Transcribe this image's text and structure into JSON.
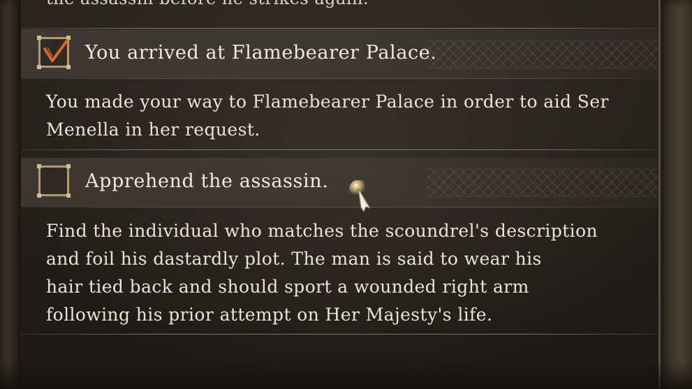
{
  "quest": {
    "previous_text_fragment": "the assassin before he strikes again.",
    "objectives": [
      {
        "completed": true,
        "title": "You arrived at Flamebearer Palace.",
        "description_lines": [
          "You made your way to Flamebearer Palace in order to aid Ser",
          "Menella in her request."
        ]
      },
      {
        "completed": false,
        "title": "Apprehend the assassin.",
        "description_lines": [
          "Find the individual who matches the scoundrel's description",
          "and foil his dastardly plot. The man is said to wear his",
          "hair tied back and should sport a wounded right arm",
          "following his prior attempt on Her Majesty's life."
        ]
      }
    ]
  },
  "icons": {
    "checkmark": "checkmark-icon",
    "cursor": "pointer-cursor-icon"
  },
  "colors": {
    "checkmark": "#d8692a",
    "checkbox_border": "#b49a72",
    "text": "#ebe4d4",
    "cursor_glow": "#f5d98a"
  }
}
